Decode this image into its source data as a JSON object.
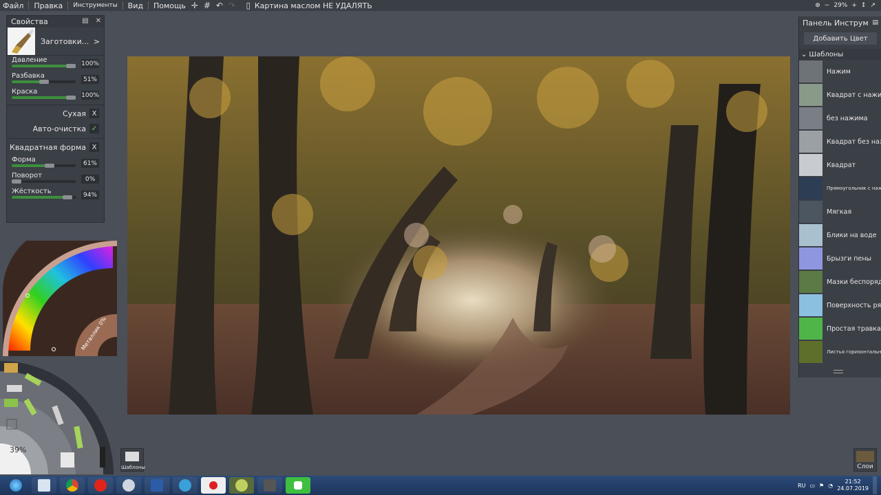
{
  "menubar": {
    "items": [
      "Файл",
      "Правка",
      "Инструменты",
      "Вид",
      "Помощь"
    ],
    "document_title": "Картина маслом НЕ УДАЛЯТЬ",
    "zoom": "29%"
  },
  "properties": {
    "title": "Свойства",
    "preset_label": "Заготовки...",
    "preset_arrow": ">",
    "sliders_top": [
      {
        "label": "Давление",
        "value": "100%",
        "level": 1.0
      },
      {
        "label": "Разбавка",
        "value": "51%",
        "level": 0.51
      },
      {
        "label": "Краска",
        "value": "100%",
        "level": 1.0
      }
    ],
    "toggles": [
      {
        "label": "Сухая",
        "mark": "X"
      },
      {
        "label": "Авто-очистка",
        "mark": "✓"
      }
    ],
    "square_shape": {
      "label": "Квадратная форма",
      "mark": "X"
    },
    "sliders_bottom": [
      {
        "label": "Форма",
        "value": "61%",
        "level": 0.61
      },
      {
        "label": "Поворот",
        "value": "0%",
        "level": 0.0
      },
      {
        "label": "Жёсткость",
        "value": "94%",
        "level": 0.94
      }
    ]
  },
  "color_wheel": {
    "metallic_label": "Металлик 0%"
  },
  "tools": {
    "size_percent": "39%"
  },
  "templates_button": {
    "label": "Шаблоны"
  },
  "right_panel": {
    "title": "Панель Инструм",
    "add_color": "Добавить Цвет",
    "section": "Шаблоны",
    "items": [
      {
        "name": "Нажим",
        "color": "#6e7378"
      },
      {
        "name": "Квадрат с нажимом",
        "color": "#8a9a8a"
      },
      {
        "name": "без нажима",
        "color": "#7a7f86"
      },
      {
        "name": "Квадрат без нажима",
        "color": "#9aa0a4"
      },
      {
        "name": "Квадрат",
        "color": "#c8ccd0"
      },
      {
        "name": "Прямоугольник с нажимом",
        "color": "#2d3e54"
      },
      {
        "name": "Мягкая",
        "color": "#4b5660"
      },
      {
        "name": "Блики на воде",
        "color": "#a9c0cf"
      },
      {
        "name": "Брызги пены",
        "color": "#8f96e0"
      },
      {
        "name": "Мазки беспорядочные",
        "color": "#5b7a46"
      },
      {
        "name": "Поверхность рябая",
        "color": "#8cc0e0"
      },
      {
        "name": "Простая травка",
        "color": "#4fb548"
      },
      {
        "name": "Листья горизонтальные",
        "color": "#5e6f2c"
      }
    ]
  },
  "layers_button": {
    "label": "Слои"
  },
  "taskbar": {
    "lang": "RU",
    "time": "21:52",
    "date": "24.07.2019"
  }
}
